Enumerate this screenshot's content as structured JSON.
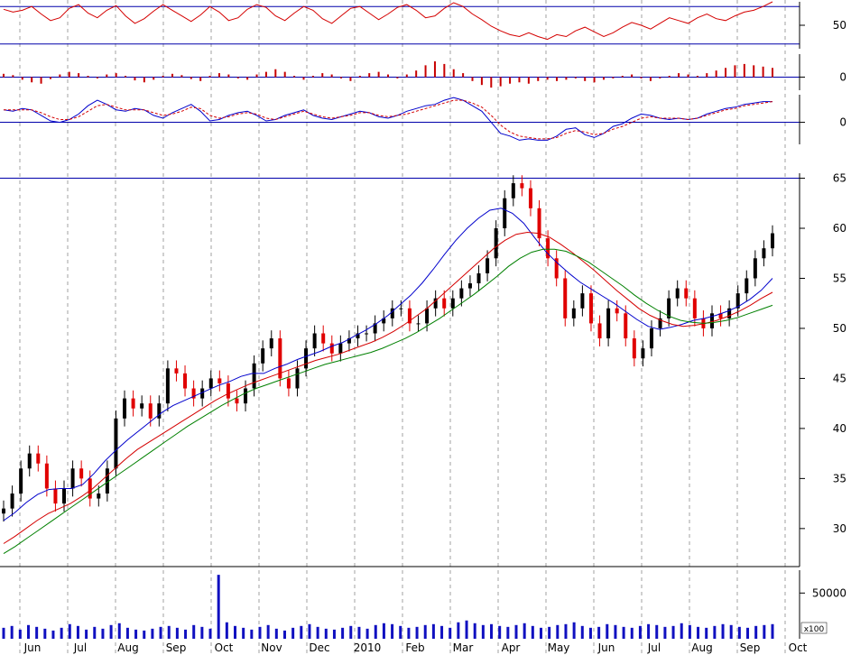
{
  "colors": {
    "rsi": "#d40000",
    "bars": "#c80000",
    "signal": "#0000cc",
    "candle_down": "#e00000",
    "candle_up": "#000000",
    "ma_short": "#0000cc",
    "ma_mid": "#d40000",
    "ma_long": "#008000",
    "volume": "#1010c0",
    "grid": "#a0a0a0"
  },
  "chart_data": [
    {
      "type": "line",
      "panel": "rsi",
      "y_ticks": [
        {
          "value": 50,
          "label": "50"
        }
      ],
      "reference_lines": [
        70,
        30
      ],
      "ylim": [
        25,
        75
      ],
      "series": [
        {
          "values": [
            67,
            64,
            66,
            70,
            62,
            55,
            58,
            68,
            72,
            63,
            58,
            66,
            71,
            60,
            52,
            57,
            65,
            72,
            66,
            60,
            54,
            61,
            70,
            64,
            55,
            58,
            67,
            72,
            69,
            60,
            55,
            63,
            70,
            66,
            57,
            52,
            60,
            68,
            70,
            63,
            56,
            62,
            69,
            72,
            66,
            58,
            60,
            68,
            74,
            70,
            62,
            56,
            49,
            44,
            40,
            38,
            42,
            38,
            35,
            40,
            38,
            44,
            48,
            43,
            38,
            42,
            48,
            53,
            50,
            46,
            52,
            58,
            55,
            52,
            58,
            62,
            57,
            55,
            60,
            64,
            66,
            70,
            75
          ]
        }
      ]
    },
    {
      "type": "bar",
      "panel": "histogram",
      "y_ticks": [
        {
          "value": 0,
          "label": "0"
        }
      ],
      "ylim": [
        -20,
        35
      ],
      "series": [
        {
          "values": [
            5,
            3,
            -4,
            -8,
            -10,
            -3,
            4,
            8,
            6,
            2,
            -2,
            4,
            6,
            2,
            -5,
            -8,
            -4,
            2,
            5,
            3,
            -3,
            -6,
            2,
            6,
            4,
            -2,
            -4,
            4,
            8,
            12,
            8,
            2,
            -4,
            2,
            6,
            4,
            -2,
            -6,
            2,
            6,
            8,
            4,
            -2,
            4,
            10,
            18,
            24,
            20,
            12,
            6,
            -6,
            -12,
            -16,
            -14,
            -10,
            -8,
            -10,
            -6,
            -4,
            -6,
            -4,
            -2,
            -6,
            -8,
            -4,
            -2,
            2,
            4,
            -2,
            -6,
            -2,
            2,
            6,
            4,
            2,
            6,
            10,
            14,
            18,
            20,
            18,
            16,
            14
          ]
        }
      ]
    },
    {
      "type": "line",
      "panel": "macd",
      "y_ticks": [
        {
          "value": 0,
          "label": "0"
        }
      ],
      "ylim": [
        -1.6,
        2.0
      ],
      "series": [
        {
          "values": [
            0.9,
            0.8,
            1.0,
            0.9,
            0.5,
            0.1,
            0.0,
            0.2,
            0.6,
            1.2,
            1.6,
            1.3,
            0.9,
            0.8,
            1.0,
            0.9,
            0.5,
            0.3,
            0.7,
            1.0,
            1.3,
            0.8,
            0.1,
            0.2,
            0.5,
            0.7,
            0.8,
            0.5,
            0.1,
            0.2,
            0.5,
            0.7,
            0.9,
            0.5,
            0.3,
            0.2,
            0.4,
            0.6,
            0.8,
            0.7,
            0.4,
            0.3,
            0.5,
            0.8,
            1.0,
            1.2,
            1.3,
            1.6,
            1.8,
            1.6,
            1.2,
            0.8,
            0.0,
            -0.8,
            -1.0,
            -1.3,
            -1.2,
            -1.3,
            -1.3,
            -1.0,
            -0.5,
            -0.4,
            -0.9,
            -1.1,
            -0.8,
            -0.3,
            -0.1,
            0.3,
            0.6,
            0.5,
            0.3,
            0.2,
            0.3,
            0.2,
            0.3,
            0.6,
            0.8,
            1.0,
            1.1,
            1.3,
            1.4,
            1.5,
            1.5
          ]
        },
        {
          "values": [
            0.9,
            0.9,
            0.9,
            0.9,
            0.7,
            0.4,
            0.2,
            0.2,
            0.4,
            0.8,
            1.2,
            1.3,
            1.1,
            0.9,
            0.9,
            0.9,
            0.7,
            0.5,
            0.6,
            0.8,
            1.1,
            1.0,
            0.5,
            0.3,
            0.4,
            0.6,
            0.7,
            0.6,
            0.3,
            0.2,
            0.4,
            0.6,
            0.8,
            0.6,
            0.4,
            0.3,
            0.4,
            0.5,
            0.7,
            0.7,
            0.5,
            0.4,
            0.5,
            0.6,
            0.8,
            1.0,
            1.2,
            1.4,
            1.6,
            1.6,
            1.4,
            1.1,
            0.5,
            -0.2,
            -0.7,
            -1.0,
            -1.1,
            -1.2,
            -1.2,
            -1.1,
            -0.8,
            -0.6,
            -0.7,
            -0.9,
            -0.8,
            -0.5,
            -0.3,
            0.0,
            0.3,
            0.4,
            0.3,
            0.3,
            0.3,
            0.2,
            0.3,
            0.5,
            0.7,
            0.9,
            1.0,
            1.2,
            1.3,
            1.4,
            1.5
          ]
        }
      ]
    },
    {
      "type": "candlestick",
      "panel": "price",
      "y_ticks": [
        {
          "value": 65,
          "label": "65"
        },
        {
          "value": 60,
          "label": "60"
        },
        {
          "value": 55,
          "label": "55"
        },
        {
          "value": 50,
          "label": "50"
        },
        {
          "value": 45,
          "label": "45"
        },
        {
          "value": 40,
          "label": "40"
        },
        {
          "value": 35,
          "label": "35"
        },
        {
          "value": 30,
          "label": "30"
        }
      ],
      "reference_lines": [
        65
      ],
      "ylim": [
        26.2,
        65.5
      ],
      "x_ticks": [
        "Jun",
        "Jul",
        "Aug",
        "Sep",
        "Oct",
        "Nov",
        "Dec",
        "2010",
        "Feb",
        "Mar",
        "Apr",
        "May",
        "Jun",
        "Jul",
        "Aug",
        "Sep",
        "Oct"
      ],
      "close": [
        32,
        33.5,
        36,
        37.5,
        36.5,
        34,
        32.5,
        34,
        36,
        35,
        33,
        33.5,
        36,
        41,
        43,
        42,
        42.5,
        41,
        42.5,
        46,
        45.5,
        44,
        43,
        44,
        45,
        44.5,
        43,
        42.5,
        44,
        46.5,
        48,
        49,
        45,
        44,
        46,
        48,
        49.5,
        48.5,
        47.5,
        48.5,
        49,
        49.5,
        49.5,
        50.5,
        51,
        52,
        52,
        50.5,
        50.5,
        52,
        53,
        52,
        53,
        54,
        54.5,
        55.5,
        57,
        60,
        63,
        64.5,
        64,
        62,
        59,
        57,
        55,
        51,
        52,
        53.5,
        50.5,
        49,
        52,
        51.5,
        49,
        47,
        48,
        50,
        51,
        53,
        54,
        53,
        51,
        50,
        51.5,
        51,
        52,
        53.5,
        55,
        57,
        58,
        59.5
      ],
      "series": [
        {
          "name": "",
          "values": [
            30.8,
            31.6,
            32.6,
            33.4,
            33.9,
            34.0,
            34.0,
            34.4,
            35.5,
            36.8,
            37.9,
            38.9,
            39.8,
            40.7,
            41.6,
            42.3,
            42.8,
            43.3,
            43.8,
            44.3,
            44.7,
            45.2,
            45.5,
            45.5,
            46.0,
            46.4,
            46.9,
            47.3,
            47.7,
            48.2,
            48.6,
            49.2,
            49.8,
            50.5,
            51.3,
            52.3,
            53.3,
            54.5,
            55.9,
            57.4,
            58.8,
            60.0,
            61.0,
            61.8,
            62.0,
            61.5,
            60.5,
            59.0,
            57.6,
            56.5,
            55.5,
            54.6,
            53.9,
            53.2,
            52.5,
            51.7,
            50.9,
            50.2,
            49.9,
            50.1,
            50.4,
            50.8,
            51.0,
            51.3,
            51.7,
            52.2,
            52.9,
            53.8,
            55.0
          ]
        },
        {
          "name": "",
          "values": [
            28.5,
            29.2,
            30.0,
            30.8,
            31.5,
            32.0,
            32.5,
            33.2,
            34.0,
            35.0,
            36.0,
            37.0,
            37.9,
            38.6,
            39.3,
            40.0,
            40.7,
            41.4,
            42.1,
            42.8,
            43.4,
            43.9,
            44.4,
            44.8,
            45.2,
            45.6,
            46.0,
            46.4,
            46.8,
            47.1,
            47.4,
            47.8,
            48.2,
            48.6,
            49.1,
            49.7,
            50.4,
            51.2,
            52.0,
            53.0,
            54.0,
            55.0,
            56.0,
            57.0,
            58.0,
            58.8,
            59.4,
            59.6,
            59.5,
            59.1,
            58.4,
            57.6,
            56.7,
            55.8,
            54.8,
            53.8,
            52.9,
            52.0,
            51.3,
            50.8,
            50.4,
            50.2,
            50.3,
            50.5,
            50.8,
            51.2,
            51.7,
            52.3,
            53.0,
            53.6
          ]
        },
        {
          "name": "",
          "values": [
            27.5,
            28.2,
            29.0,
            29.8,
            30.6,
            31.4,
            32.2,
            33.0,
            33.8,
            34.6,
            35.4,
            36.2,
            37.0,
            37.8,
            38.6,
            39.4,
            40.2,
            40.9,
            41.6,
            42.3,
            42.9,
            43.5,
            44.0,
            44.4,
            44.8,
            45.2,
            45.6,
            46.0,
            46.4,
            46.7,
            47.0,
            47.3,
            47.6,
            48.0,
            48.5,
            49.0,
            49.6,
            50.3,
            51.0,
            51.8,
            52.6,
            53.4,
            54.3,
            55.2,
            56.2,
            57.0,
            57.6,
            57.9,
            57.9,
            57.7,
            57.2,
            56.6,
            55.8,
            55.0,
            54.2,
            53.3,
            52.5,
            51.8,
            51.2,
            50.8,
            50.6,
            50.5,
            50.6,
            50.8,
            51.1,
            51.5,
            51.9,
            52.3
          ]
        }
      ]
    },
    {
      "type": "bar",
      "panel": "volume",
      "y_ticks": [
        {
          "value": 50000,
          "label": "50000"
        }
      ],
      "ylim": [
        0,
        75000
      ],
      "multiplier_label": "x100",
      "series": [
        {
          "values": [
            12000,
            14000,
            10000,
            15000,
            13000,
            11000,
            9000,
            12000,
            16000,
            14000,
            10000,
            13000,
            11000,
            15000,
            17000,
            12000,
            10000,
            9000,
            11000,
            13000,
            14000,
            12000,
            10000,
            15000,
            13000,
            11000,
            70000,
            18000,
            14000,
            12000,
            10000,
            13000,
            15000,
            11000,
            9000,
            12000,
            14000,
            16000,
            13000,
            11000,
            10000,
            12000,
            14000,
            13000,
            11000,
            15000,
            17000,
            16000,
            14000,
            12000,
            13000,
            15000,
            16000,
            14000,
            12000,
            18000,
            20000,
            17000,
            15000,
            16000,
            14000,
            13000,
            15000,
            17000,
            14000,
            12000,
            13000,
            15000,
            16000,
            18000,
            14000,
            12000,
            13000,
            16000,
            15000,
            13000,
            12000,
            14000,
            16000,
            15000,
            13000,
            14000,
            17000,
            15000,
            13000,
            12000,
            14000,
            16000,
            15000,
            13000,
            12000,
            14000,
            15000,
            16000
          ]
        }
      ]
    }
  ]
}
